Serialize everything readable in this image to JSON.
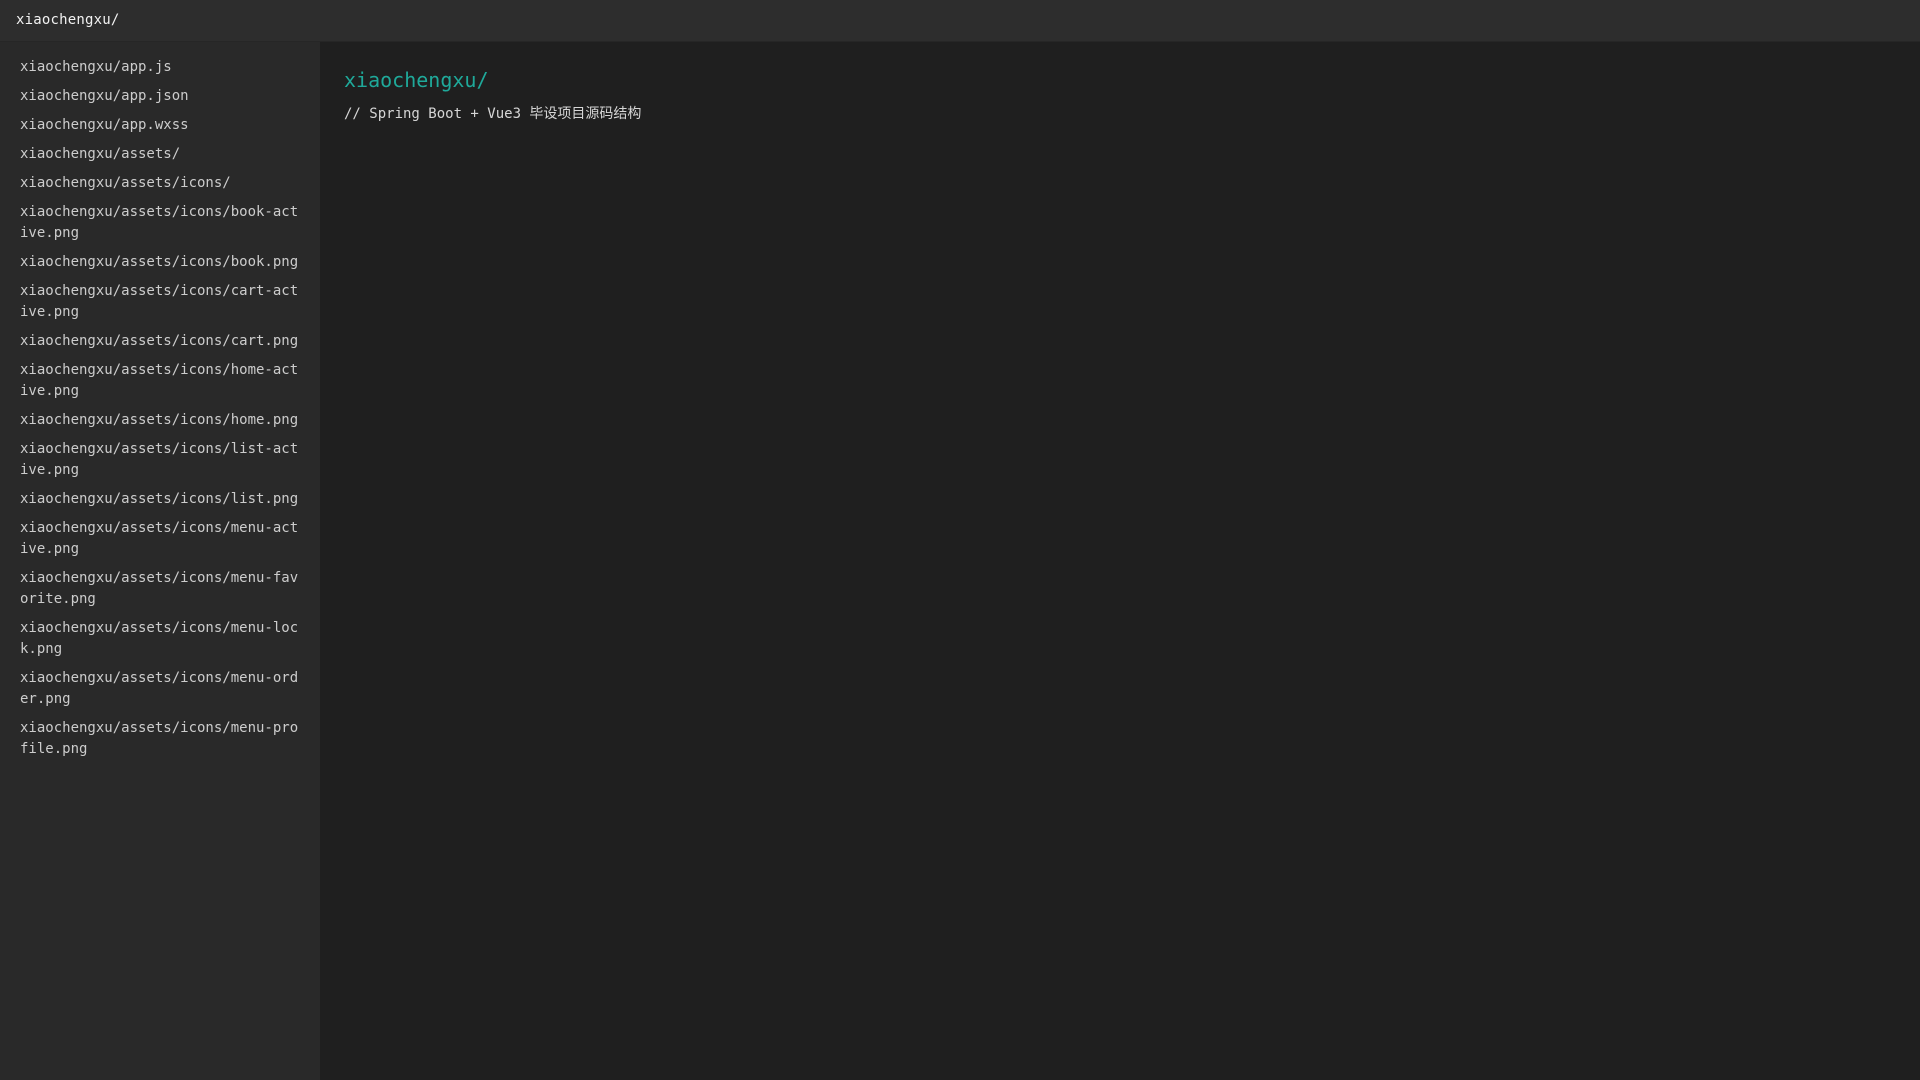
{
  "window": {
    "title": "xiaochengxu/"
  },
  "sidebar": {
    "items": [
      "xiaochengxu/app.js",
      "xiaochengxu/app.json",
      "xiaochengxu/app.wxss",
      "xiaochengxu/assets/",
      "xiaochengxu/assets/icons/",
      "xiaochengxu/assets/icons/book-active.png",
      "xiaochengxu/assets/icons/book.png",
      "xiaochengxu/assets/icons/cart-active.png",
      "xiaochengxu/assets/icons/cart.png",
      "xiaochengxu/assets/icons/home-active.png",
      "xiaochengxu/assets/icons/home.png",
      "xiaochengxu/assets/icons/list-active.png",
      "xiaochengxu/assets/icons/list.png",
      "xiaochengxu/assets/icons/menu-active.png",
      "xiaochengxu/assets/icons/menu-favorite.png",
      "xiaochengxu/assets/icons/menu-lock.png",
      "xiaochengxu/assets/icons/menu-order.png",
      "xiaochengxu/assets/icons/menu-profile.png"
    ]
  },
  "main": {
    "title": "xiaochengxu/",
    "comment": "// Spring Boot + Vue3 毕设项目源码结构"
  },
  "colors": {
    "accent": "#1fa99a",
    "topbar_bg": "#2d2d2d",
    "sidebar_bg": "#292929",
    "main_bg": "#1f1f1f"
  }
}
